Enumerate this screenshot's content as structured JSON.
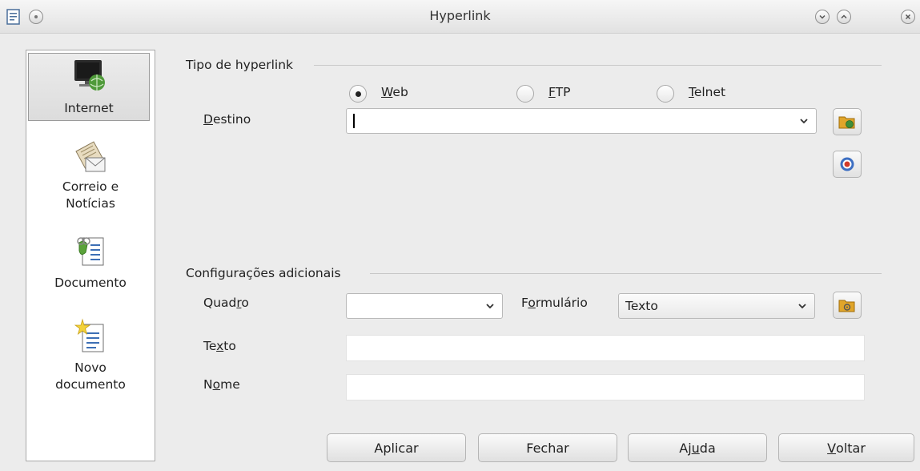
{
  "window": {
    "title": "Hyperlink"
  },
  "categories": [
    {
      "label": "Internet",
      "icon": "internet-globe-icon",
      "selected": true
    },
    {
      "label": "Correio e\nNotícias",
      "icon": "mail-news-icon",
      "selected": false
    },
    {
      "label": "Documento",
      "icon": "document-link-icon",
      "selected": false
    },
    {
      "label": "Novo\ndocumento",
      "icon": "new-document-icon",
      "selected": false
    }
  ],
  "hyperlink_type": {
    "heading": "Tipo de hyperlink",
    "options": [
      {
        "label": "Web",
        "accel": "W",
        "rest": "eb",
        "checked": true
      },
      {
        "label": "FTP",
        "accel": "F",
        "rest": "TP",
        "checked": false
      },
      {
        "label": "Telnet",
        "accel": "T",
        "rest": "elnet",
        "checked": false
      }
    ],
    "target_label_accel": "D",
    "target_label_rest": "estino",
    "target_value": ""
  },
  "additional": {
    "heading": "Configurações adicionais",
    "frame_label_pre": "Quad",
    "frame_label_accel": "r",
    "frame_label_post": "o",
    "frame_value": "",
    "form_label_pre": "F",
    "form_label_accel": "o",
    "form_label_post": "rmulário",
    "form_value": "Texto",
    "text_label_pre": "Te",
    "text_label_accel": "x",
    "text_label_post": "to",
    "text_value": "",
    "name_label_pre": "N",
    "name_label_accel": "o",
    "name_label_post": "me",
    "name_value": ""
  },
  "buttons": {
    "apply": "Aplicar",
    "close": "Fechar",
    "help_pre": "Aj",
    "help_accel": "u",
    "help_post": "da",
    "back_accel": "V",
    "back_rest": "oltar"
  },
  "colors": {
    "dialog_bg": "#ececec",
    "panel_bg": "#ffffff",
    "selected_bg": "#dcdcdc"
  }
}
